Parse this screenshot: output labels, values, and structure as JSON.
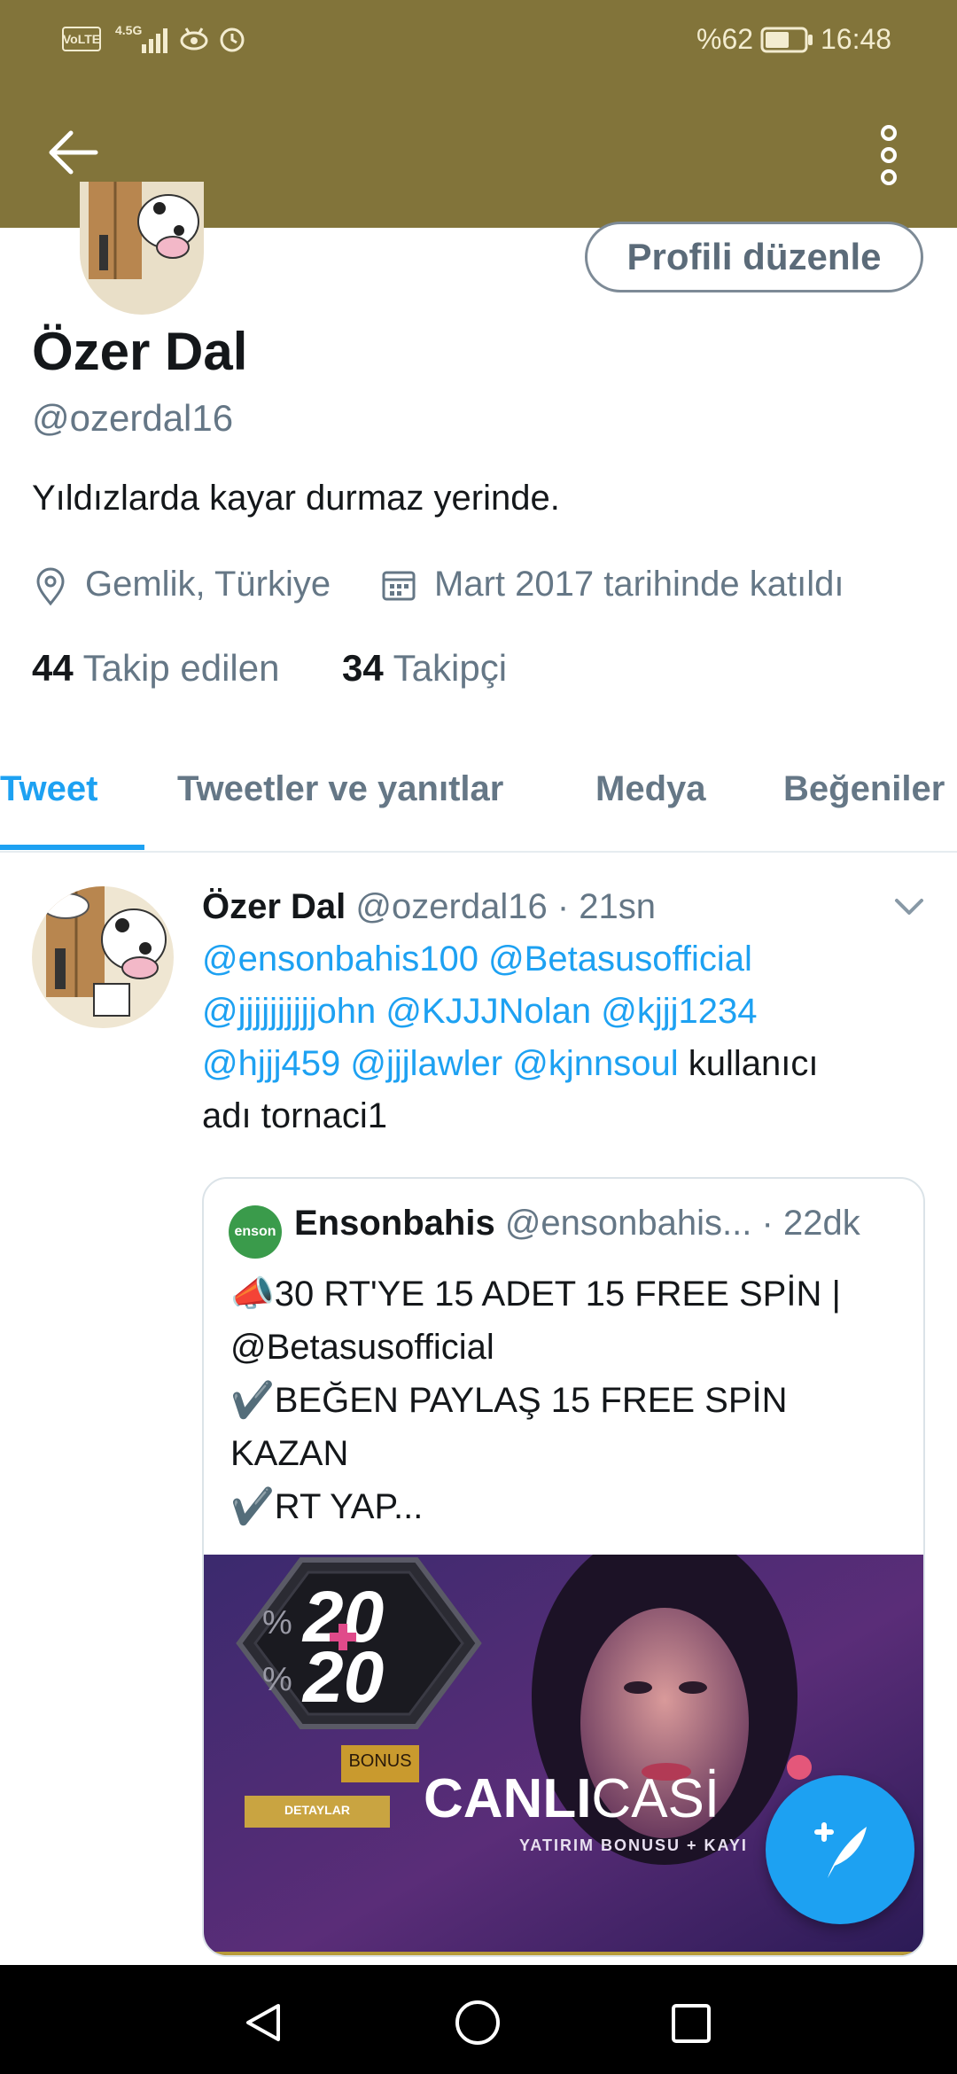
{
  "status_bar": {
    "volte": "VoLTE",
    "network": "4.5G",
    "battery_percent": "%62",
    "time": "16:48",
    "battery_level": 0.62
  },
  "app_bar": {
    "back_icon": "arrow-left-icon",
    "menu_icon": "more-vertical-icon",
    "color": "#82743a"
  },
  "profile": {
    "edit_button": "Profili düzenle",
    "name": "Özer Dal",
    "handle": "@ozerdal16",
    "bio": "Yıldızlarda kayar durmaz yerinde.",
    "location": "Gemlik, Türkiye",
    "joined": "Mart 2017 tarihinde katıldı",
    "following_count": "44",
    "following_label": "Takip edilen",
    "followers_count": "34",
    "followers_label": "Takipçi"
  },
  "tabs": [
    {
      "label": "Tweet",
      "active": true
    },
    {
      "label": "Tweetler ve yanıtlar",
      "active": false
    },
    {
      "label": "Medya",
      "active": false
    },
    {
      "label": "Beğeniler",
      "active": false
    }
  ],
  "tweet": {
    "author": "Özer Dal",
    "handle_time": "@ozerdal16 · 21sn",
    "line1": "@ensonbahis100 @Betasusofficial",
    "line2": "@jjjjjjjjjjohn @KJJJNolan @kjjj1234",
    "line3_mentions": "@hjjj459 @jjjlawler @kjnnsoul",
    "line3_text": " kullanıcı",
    "line4": "adı tornaci1",
    "quote": {
      "author": "Ensonbahis",
      "handle": "@ensonbahis...",
      "time": "· 22dk",
      "avatar_text": "enson",
      "line1": "📣30 RT'YE 15 ADET 15 FREE SPİN |",
      "line2": "@Betasusofficial",
      "line3": "✔️BEĞEN PAYLAŞ 15 FREE SPİN",
      "line4": "KAZAN",
      "line5": "✔️RT YAP...",
      "image": {
        "badge_top": "20",
        "badge_bottom": "20",
        "percent_sign": "%",
        "bonus": "BONUS",
        "details": "DETAYLAR",
        "headline_bold": "CANLI",
        "headline_light": "CASİ",
        "subline": "YATIRIM BONUSU + KAYI"
      }
    }
  },
  "fab": {
    "icon": "compose-feather-icon",
    "color": "#1da1f2"
  },
  "nav_bar": {
    "icons": [
      "back-triangle-icon",
      "home-circle-icon",
      "recents-square-icon"
    ]
  }
}
